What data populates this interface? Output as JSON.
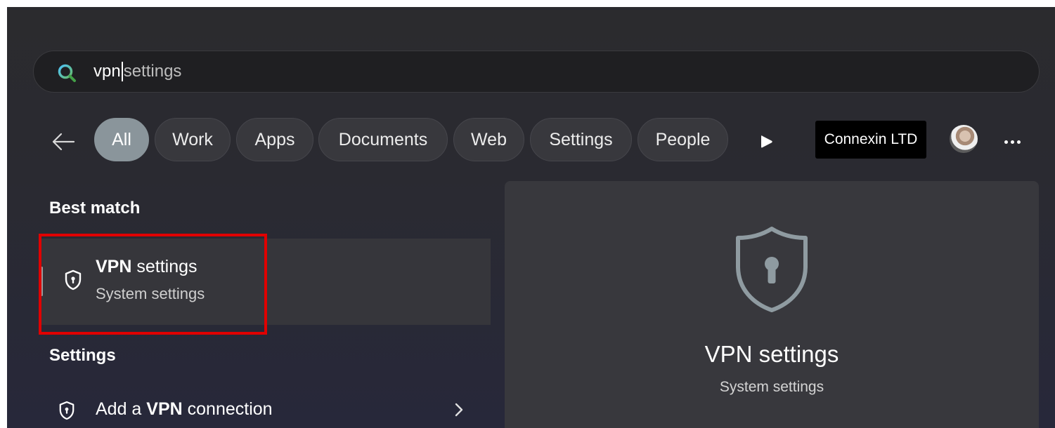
{
  "search": {
    "typed": "vpn",
    "suggestion": "settings"
  },
  "filters": {
    "back_icon": "arrow-left-icon",
    "chips": [
      {
        "label": "All",
        "active": true
      },
      {
        "label": "Work"
      },
      {
        "label": "Apps"
      },
      {
        "label": "Documents"
      },
      {
        "label": "Web"
      },
      {
        "label": "Settings"
      },
      {
        "label": "People"
      }
    ],
    "play_icon": "play-icon",
    "org_badge": "Connexin LTD",
    "more_icon": "more-horizontal-icon"
  },
  "results": {
    "best_match_heading": "Best match",
    "best_match": {
      "title_bold": "VPN",
      "title_rest": " settings",
      "subtitle": "System settings",
      "icon": "shield-lock-icon"
    },
    "settings_heading": "Settings",
    "settings_items": [
      {
        "pre": "Add a ",
        "bold": "VPN",
        "post": " connection",
        "icon": "shield-lock-icon"
      }
    ]
  },
  "preview": {
    "title": "VPN settings",
    "subtitle": "System settings",
    "icon": "shield-lock-icon"
  },
  "colors": {
    "highlight": "#e00000",
    "active_chip": "#8a959b",
    "panel_bg": "#2a2a2f"
  }
}
